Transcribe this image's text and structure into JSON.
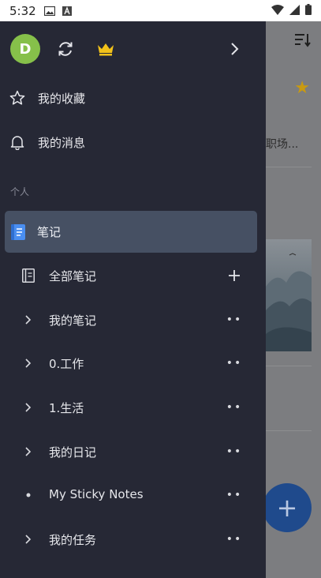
{
  "status_bar": {
    "time": "5:32"
  },
  "drawer": {
    "header": {
      "avatar_letter": "D"
    },
    "top_items": [
      {
        "label": "我的收藏",
        "icon": "star-outline-icon"
      },
      {
        "label": "我的消息",
        "icon": "bell-icon"
      }
    ],
    "section_title": "个人",
    "notes": {
      "label": "笔记",
      "icon": "notebook-icon",
      "accent": "#4a8ef0"
    },
    "tree": [
      {
        "label": "全部笔记",
        "lead": "notebook-outline-icon",
        "trail": "plus-icon"
      },
      {
        "label": "我的笔记",
        "lead": "chevron-right-icon",
        "trail": "more-icon"
      },
      {
        "label": "0.工作",
        "lead": "chevron-right-icon",
        "trail": "more-icon"
      },
      {
        "label": "1.生活",
        "lead": "chevron-right-icon",
        "trail": "more-icon"
      },
      {
        "label": "我的日记",
        "lead": "chevron-right-icon",
        "trail": "more-icon"
      },
      {
        "label": "My Sticky Notes",
        "lead": "bullet-icon",
        "trail": "more-icon"
      },
      {
        "label": "我的任务",
        "lead": "chevron-right-icon",
        "trail": "more-icon"
      }
    ]
  },
  "background_app": {
    "list_item_text": "职场..."
  },
  "colors": {
    "drawer_bg": "#262835",
    "active_row_bg": "#465063",
    "avatar_bg": "#86c04a",
    "crown": "#f2c21a",
    "fab_bg": "#1f4a8c"
  }
}
